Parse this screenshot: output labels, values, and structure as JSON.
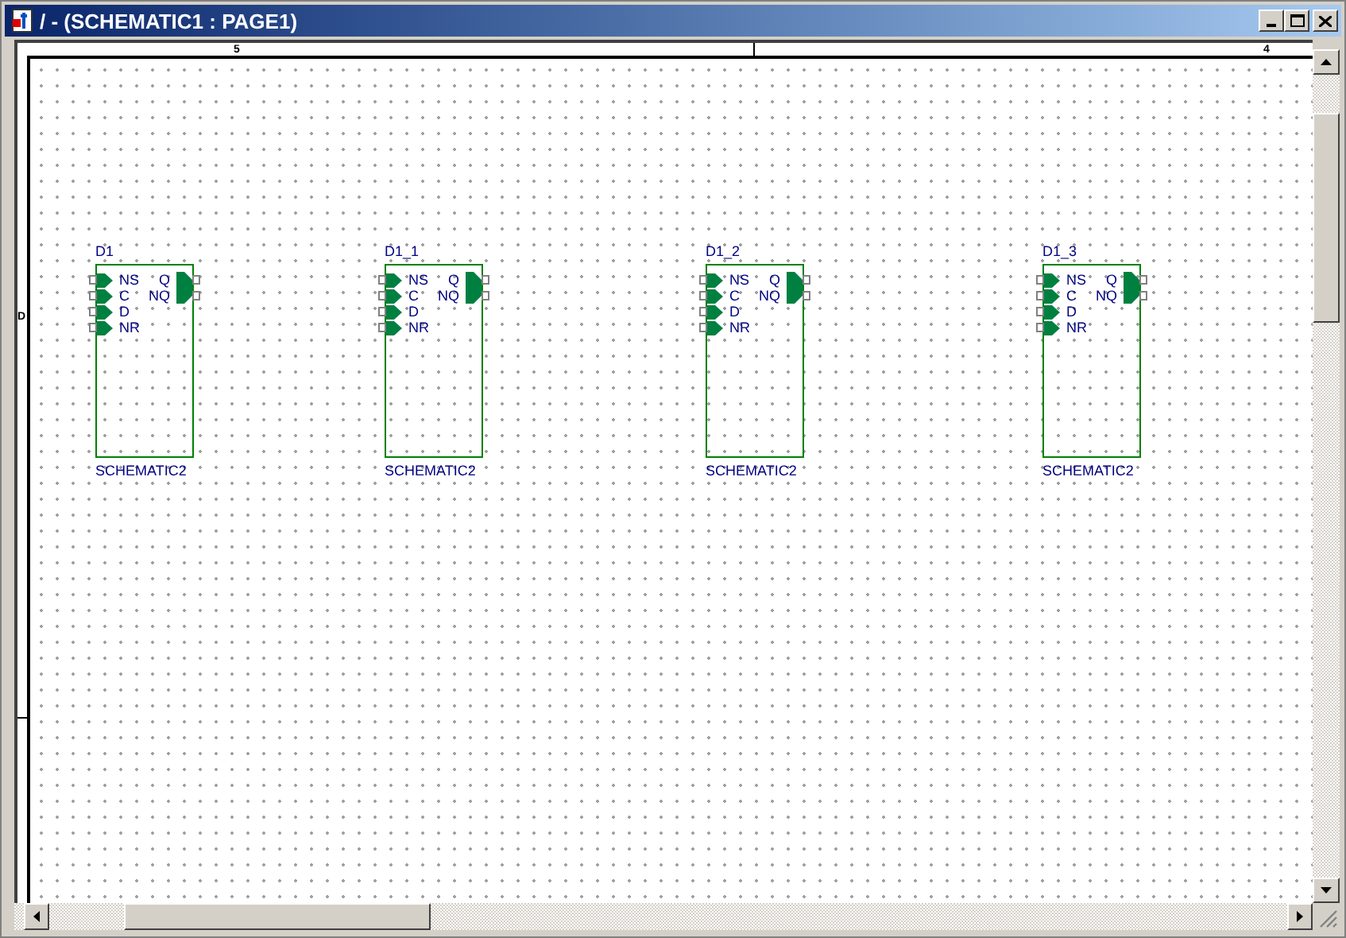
{
  "window": {
    "title": "/ - (SCHEMATIC1 : PAGE1)"
  },
  "ruler": {
    "top_labels": [
      "5",
      "4"
    ],
    "left_labels": [
      "D"
    ]
  },
  "parts": [
    {
      "ref": "D1",
      "name": "SCHEMATIC2",
      "left_pins": [
        "NS",
        "C",
        "D",
        "NR"
      ],
      "right_pins": [
        "Q",
        "NQ"
      ]
    },
    {
      "ref": "D1_1",
      "name": "SCHEMATIC2",
      "left_pins": [
        "NS",
        "C",
        "D",
        "NR"
      ],
      "right_pins": [
        "Q",
        "NQ"
      ]
    },
    {
      "ref": "D1_2",
      "name": "SCHEMATIC2",
      "left_pins": [
        "NS",
        "C",
        "D",
        "NR"
      ],
      "right_pins": [
        "Q",
        "NQ"
      ]
    },
    {
      "ref": "D1_3",
      "name": "SCHEMATIC2",
      "left_pins": [
        "NS",
        "C",
        "D",
        "NR"
      ],
      "right_pins": [
        "Q",
        "NQ"
      ]
    }
  ]
}
